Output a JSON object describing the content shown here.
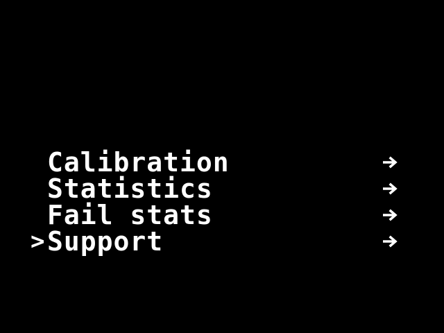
{
  "screen": {
    "background": "#000000",
    "foreground": "#ffffff"
  },
  "menu": {
    "cursor_symbol": ">",
    "selected_index": 3,
    "items": [
      {
        "label": "Calibration",
        "arrow_icon": "arrow-right-icon"
      },
      {
        "label": "Statistics",
        "arrow_icon": "arrow-right-icon"
      },
      {
        "label": "Fail stats",
        "arrow_icon": "arrow-right-icon"
      },
      {
        "label": "Support",
        "arrow_icon": "arrow-right-icon"
      }
    ]
  }
}
